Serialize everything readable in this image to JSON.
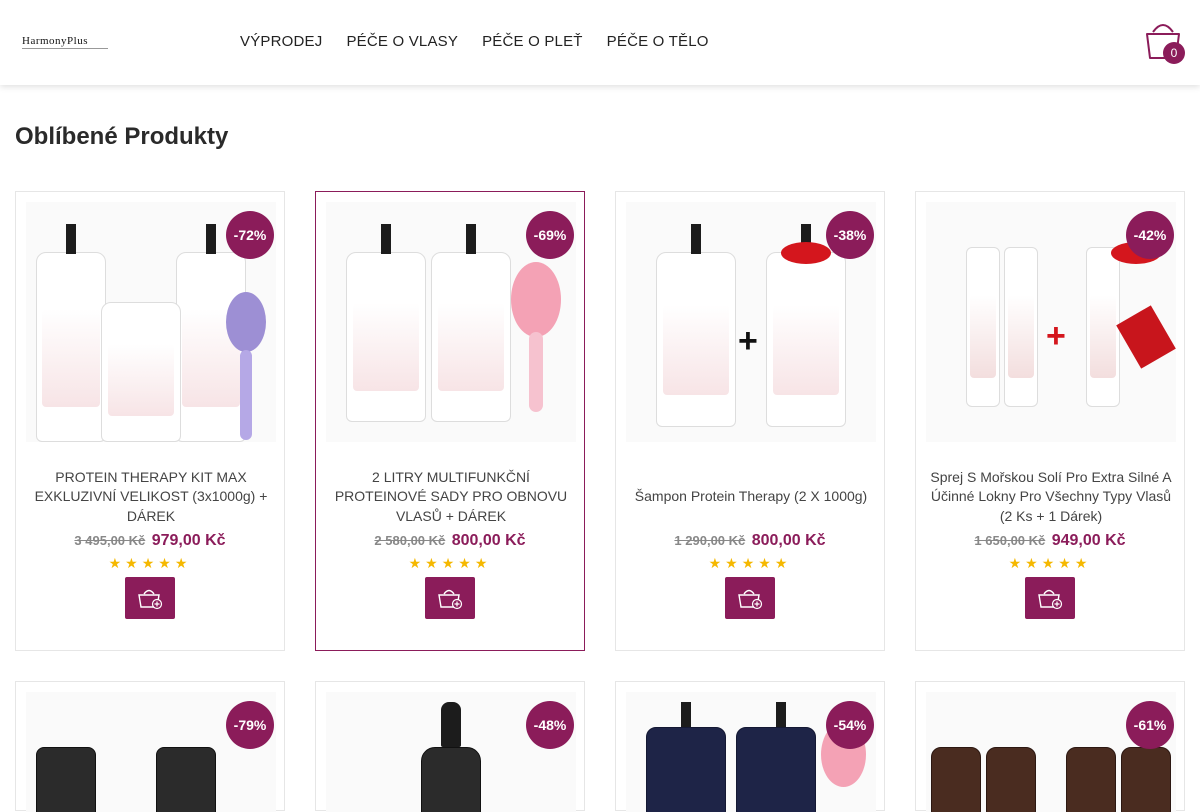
{
  "header": {
    "logo_text": "HarmonyPlus",
    "nav": [
      "VÝPRODEJ",
      "PÉČE O VLASY",
      "PÉČE O PLEŤ",
      "PÉČE O TĚLO"
    ],
    "cart_count": "0"
  },
  "section_title": "Oblíbené Produkty",
  "colors": {
    "accent": "#8b1c5a",
    "star": "#f5b800"
  },
  "products": [
    {
      "discount": "-72%",
      "name": "PROTEIN THERAPY KIT MAX EXKLUZIVNÍ VELIKOST (3x1000g) + DÁREK",
      "old_price": "3 495,00 Kč",
      "price": "979,00 Kč",
      "stars": "★★★★★"
    },
    {
      "discount": "-69%",
      "name": "2 LITRY MULTIFUNKČNÍ PROTEINOVÉ SADY PRO OBNOVU VLASŮ + DÁREK",
      "old_price": "2 580,00 Kč",
      "price": "800,00 Kč",
      "stars": "★★★★★"
    },
    {
      "discount": "-38%",
      "name": "Šampon Protein Therapy (2 X 1000g)",
      "old_price": "1 290,00 Kč",
      "price": "800,00 Kč",
      "stars": "★★★★★"
    },
    {
      "discount": "-42%",
      "name": "Sprej S Mořskou Solí Pro Extra Silné A Účinné Lokny Pro Všechny Typy Vlasů (2 Ks + 1 Dárek)",
      "old_price": "1 650,00 Kč",
      "price": "949,00 Kč",
      "stars": "★★★★★"
    },
    {
      "discount": "-79%"
    },
    {
      "discount": "-48%"
    },
    {
      "discount": "-54%"
    },
    {
      "discount": "-61%"
    }
  ]
}
